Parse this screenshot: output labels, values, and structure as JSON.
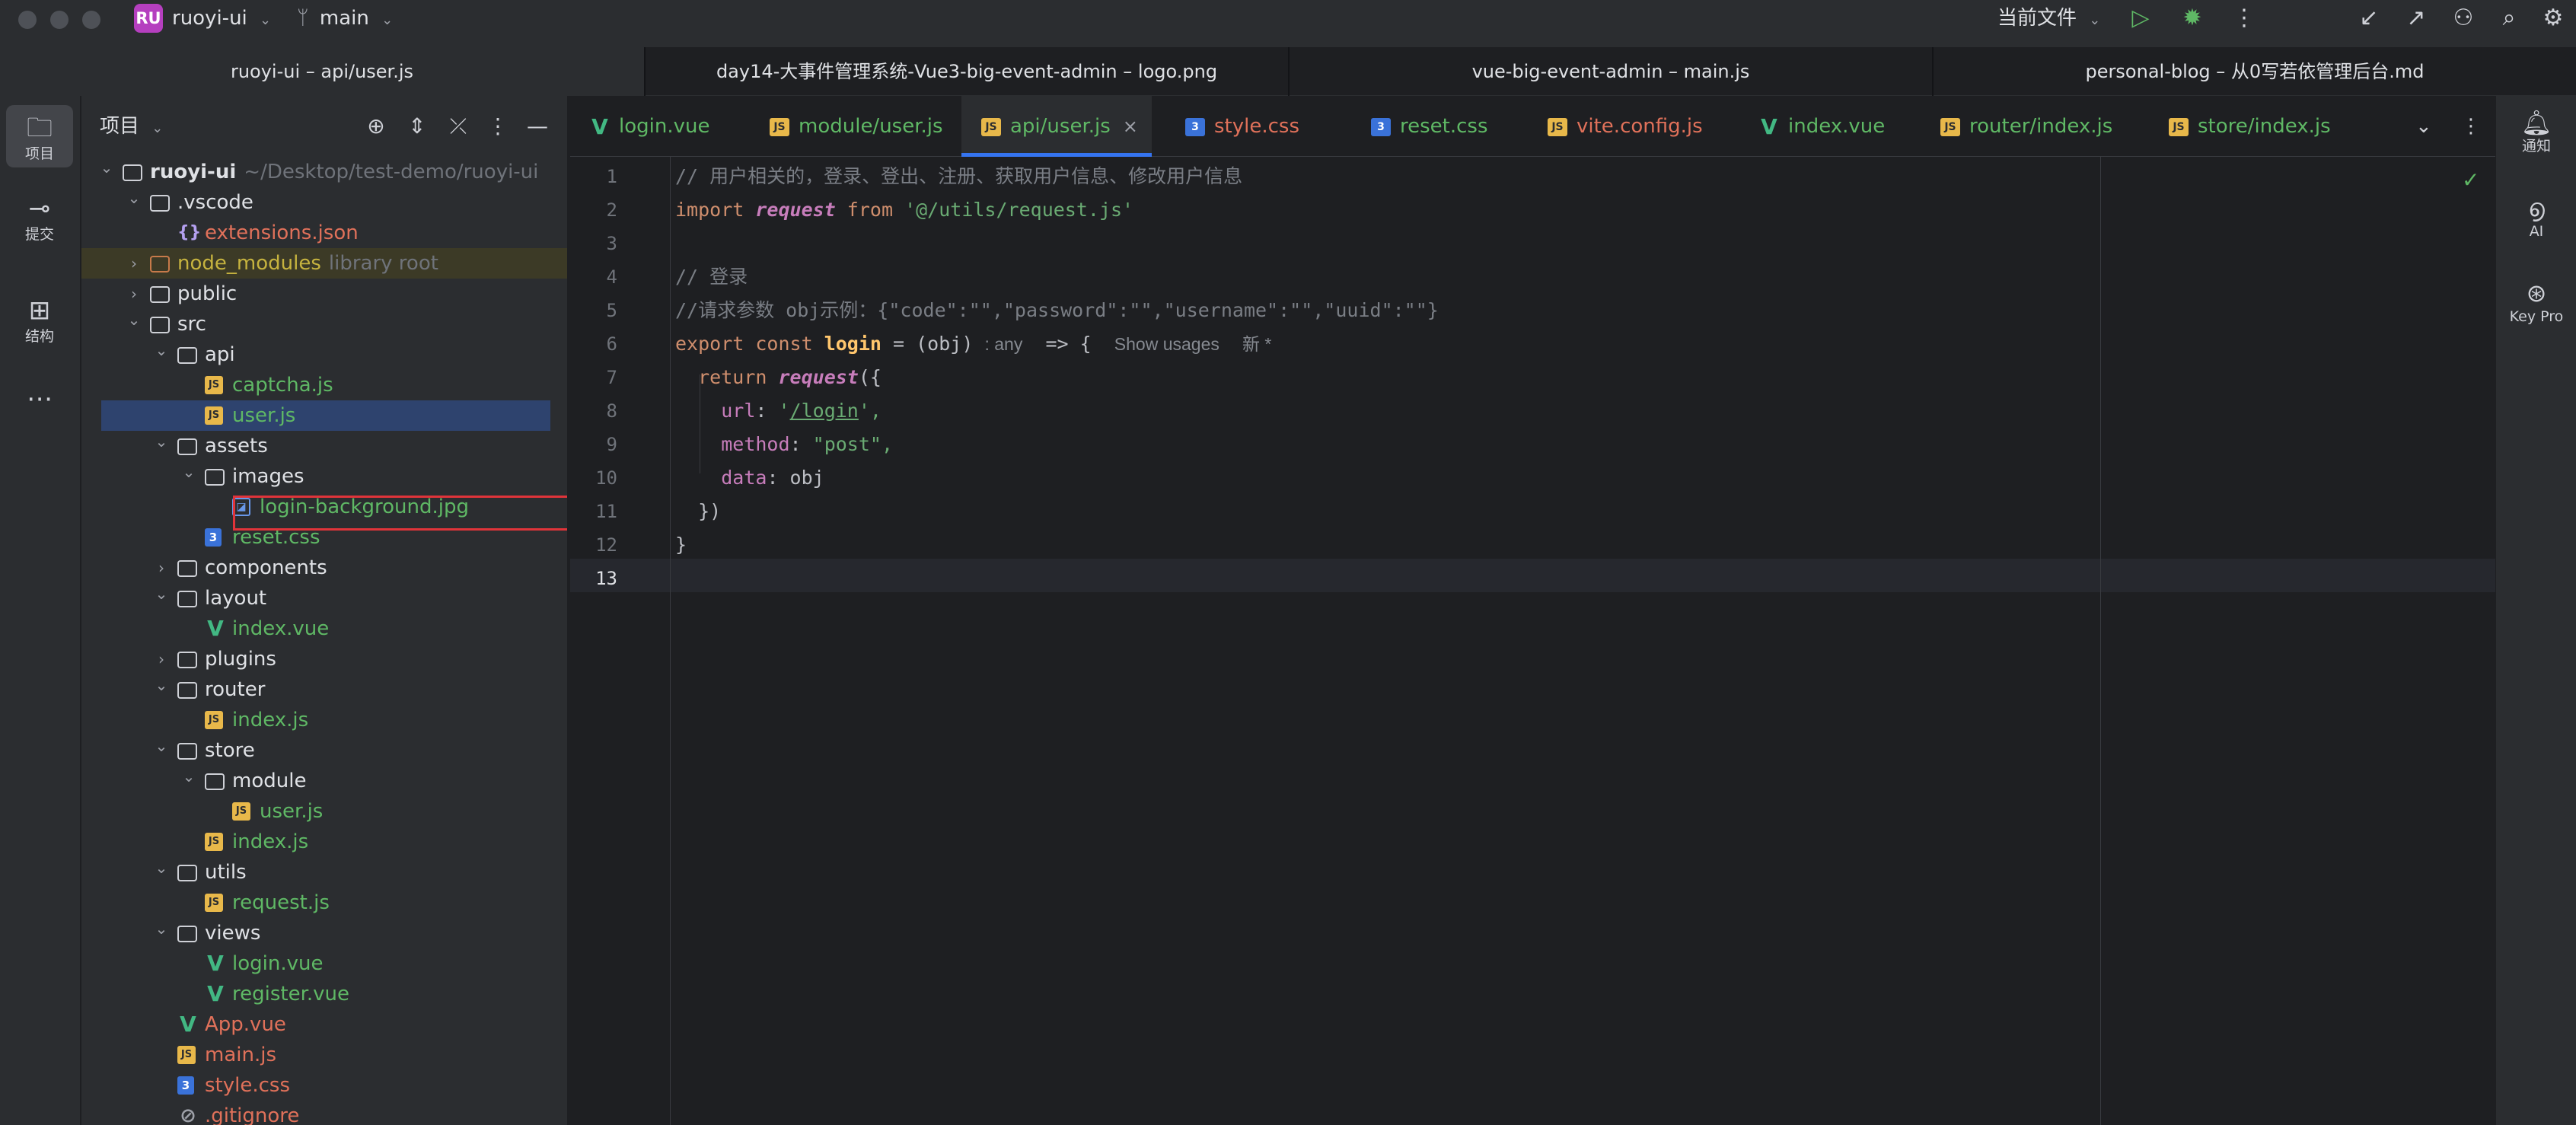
{
  "titlebar": {
    "project_badge": "RU",
    "project_name": "ruoyi-ui",
    "branch": "main",
    "run_config": "当前文件"
  },
  "window_tabs": [
    "ruoyi-ui – api/user.js",
    "day14-大事件管理系统-Vue3-big-event-admin – logo.png",
    "vue-big-event-admin – main.js",
    "personal-blog – 从0写若依管理后台.md"
  ],
  "left_toolbar": {
    "items": [
      {
        "label": "项目",
        "icon": "folder-icon"
      },
      {
        "label": "提交",
        "icon": "commit-icon"
      },
      {
        "label": "结构",
        "icon": "structure-icon"
      }
    ]
  },
  "right_toolbar": {
    "items": [
      {
        "label": "通知",
        "icon": "bell-icon"
      },
      {
        "label": "AI",
        "icon": "ai-icon"
      },
      {
        "label": "Key Pro",
        "icon": "key-promoter-icon"
      }
    ]
  },
  "project_panel": {
    "title": "项目",
    "tree": [
      {
        "name": "ruoyi-ui",
        "hint": "~/Desktop/test-demo/ruoyi-ui",
        "type": "folder",
        "expanded": true
      },
      {
        "name": ".vscode",
        "type": "folder",
        "expanded": true
      },
      {
        "name": "extensions.json",
        "type": "json"
      },
      {
        "name": "node_modules",
        "hint": "library root",
        "type": "folder-excluded",
        "expanded": false
      },
      {
        "name": "public",
        "type": "folder"
      },
      {
        "name": "src",
        "type": "folder",
        "expanded": true
      },
      {
        "name": "api",
        "type": "folder",
        "expanded": true
      },
      {
        "name": "captcha.js",
        "type": "js"
      },
      {
        "name": "user.js",
        "type": "js",
        "selected": true
      },
      {
        "name": "assets",
        "type": "folder",
        "expanded": true
      },
      {
        "name": "images",
        "type": "folder",
        "expanded": true
      },
      {
        "name": "login-background.jpg",
        "type": "image"
      },
      {
        "name": "reset.css",
        "type": "css"
      },
      {
        "name": "components",
        "type": "folder"
      },
      {
        "name": "layout",
        "type": "folder",
        "expanded": true
      },
      {
        "name": "index.vue",
        "type": "vue"
      },
      {
        "name": "plugins",
        "type": "folder"
      },
      {
        "name": "router",
        "type": "folder",
        "expanded": true
      },
      {
        "name": "index.js",
        "type": "js"
      },
      {
        "name": "store",
        "type": "folder",
        "expanded": true
      },
      {
        "name": "module",
        "type": "folder",
        "expanded": true
      },
      {
        "name": "user.js",
        "type": "js"
      },
      {
        "name": "index.js",
        "type": "js"
      },
      {
        "name": "utils",
        "type": "folder",
        "expanded": true
      },
      {
        "name": "request.js",
        "type": "js"
      },
      {
        "name": "views",
        "type": "folder",
        "expanded": true
      },
      {
        "name": "login.vue",
        "type": "vue"
      },
      {
        "name": "register.vue",
        "type": "vue"
      },
      {
        "name": "App.vue",
        "type": "vue"
      },
      {
        "name": "main.js",
        "type": "js"
      },
      {
        "name": "style.css",
        "type": "css"
      },
      {
        "name": ".gitignore",
        "type": "ignore"
      }
    ]
  },
  "editor_tabs": [
    {
      "label": "login.vue",
      "type": "vue",
      "color": "#5fb865"
    },
    {
      "label": "module/user.js",
      "type": "js",
      "color": "#5fb865"
    },
    {
      "label": "api/user.js",
      "type": "js",
      "color": "#5fb865",
      "active": true,
      "close": "×"
    },
    {
      "label": "style.css",
      "type": "css",
      "color": "#e0715a"
    },
    {
      "label": "reset.css",
      "type": "css",
      "color": "#5fb865"
    },
    {
      "label": "vite.config.js",
      "type": "js",
      "color": "#e0715a"
    },
    {
      "label": "index.vue",
      "type": "vue",
      "color": "#5fb865"
    },
    {
      "label": "router/index.js",
      "type": "js",
      "color": "#5fb865"
    },
    {
      "label": "store/index.js",
      "type": "js",
      "color": "#5fb865"
    }
  ],
  "code": {
    "line_numbers": [
      "1",
      "2",
      "3",
      "4",
      "5",
      "6",
      "7",
      "8",
      "9",
      "10",
      "11",
      "12",
      "13"
    ],
    "line1_comment": "// 用户相关的，登录、登出、注册、获取用户信息、修改用户信息",
    "line2_import": "import",
    "line2_name": "request",
    "line2_from": "from",
    "line2_path": "'@/utils/request.js'",
    "line4_comment": "// 登录",
    "line5_comment": "//请求参数 obj示例：{\"code\":\"\",\"password\":\"\",\"username\":\"\",\"uuid\":\"\"}",
    "line6_export": "export",
    "line6_const": "const",
    "line6_name": "login",
    "line6_params": "= (obj)",
    "line6_type_hint": ": any",
    "line6_arrow": " => {",
    "line6_usages": "Show usages",
    "line6_new": "新 *",
    "line7_return": "return",
    "line7_call": "request",
    "line7_open": "({",
    "line8_key": "url",
    "line8_val_q1": "'",
    "line8_val": "/login",
    "line8_val_q2": "',",
    "line9_key": "method",
    "line9_val": "\"post\",",
    "line10_key": "data",
    "line10_val": "obj",
    "line11": "})",
    "line12": "}"
  },
  "colors": {
    "accent": "#3574f0",
    "selection_box": "#e0343a",
    "badge": "#b53fbf"
  }
}
